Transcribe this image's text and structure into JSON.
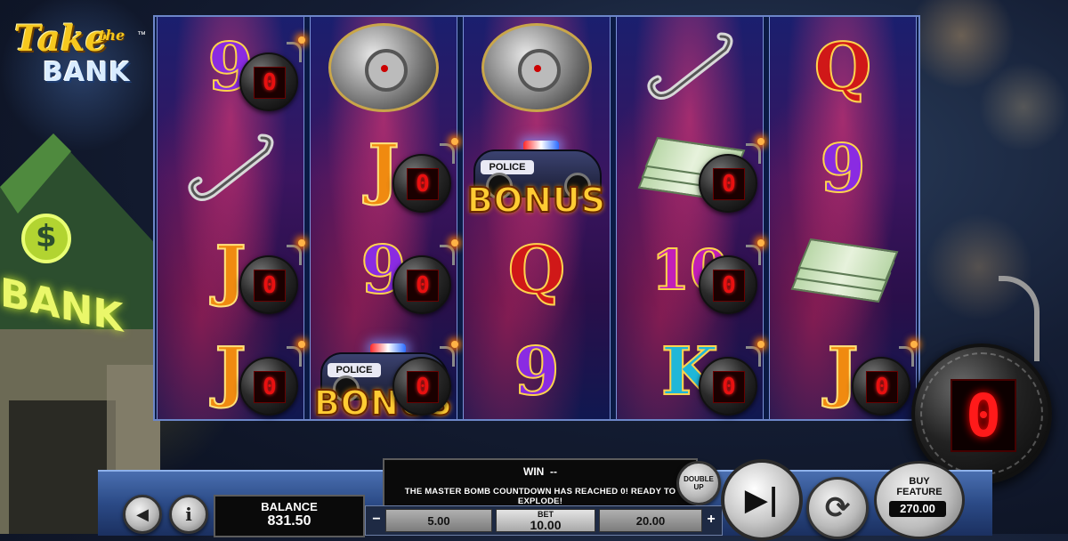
{
  "game": {
    "logo_line1": "Take",
    "logo_line2": "the",
    "logo_line3": "BANK",
    "logo_tm": "™"
  },
  "building": {
    "sign": "BANK",
    "sign_symbol": "$"
  },
  "reels": [
    [
      "9",
      "hook",
      "J",
      "J"
    ],
    [
      "vault",
      "J",
      "9",
      "police"
    ],
    [
      "vault",
      "police",
      "Q",
      "9"
    ],
    [
      "hook",
      "cash",
      "10",
      "K"
    ],
    [
      "Q",
      "9",
      "cash",
      "J"
    ]
  ],
  "bomb_counter": "0",
  "bonus_label": "BONUS",
  "police_label": "POLICE",
  "master_bomb": {
    "counter": "0"
  },
  "controls": {
    "back_icon": "back-arrow-icon",
    "info_icon": "info-icon",
    "info_glyph": "i",
    "back_glyph": "◀",
    "balance_label": "BALANCE",
    "balance_value": "831.50",
    "win_label": "WIN",
    "win_value": "--",
    "message": "THE MASTER BOMB COUNTDOWN HAS REACHED 0! READY TO EXPLODE!",
    "double_up_line1": "DOUBLE",
    "double_up_line2": "UP",
    "bet_minus": "−",
    "bet_plus": "+",
    "bet_left": "5.00",
    "bet_label": "BET",
    "bet_value": "10.00",
    "bet_right": "20.00",
    "spin_glyph": "▶|",
    "autoplay_glyph": "⟳",
    "buy_feature_line1": "BUY",
    "buy_feature_line2": "FEATURE",
    "buy_feature_price": "270.00"
  }
}
